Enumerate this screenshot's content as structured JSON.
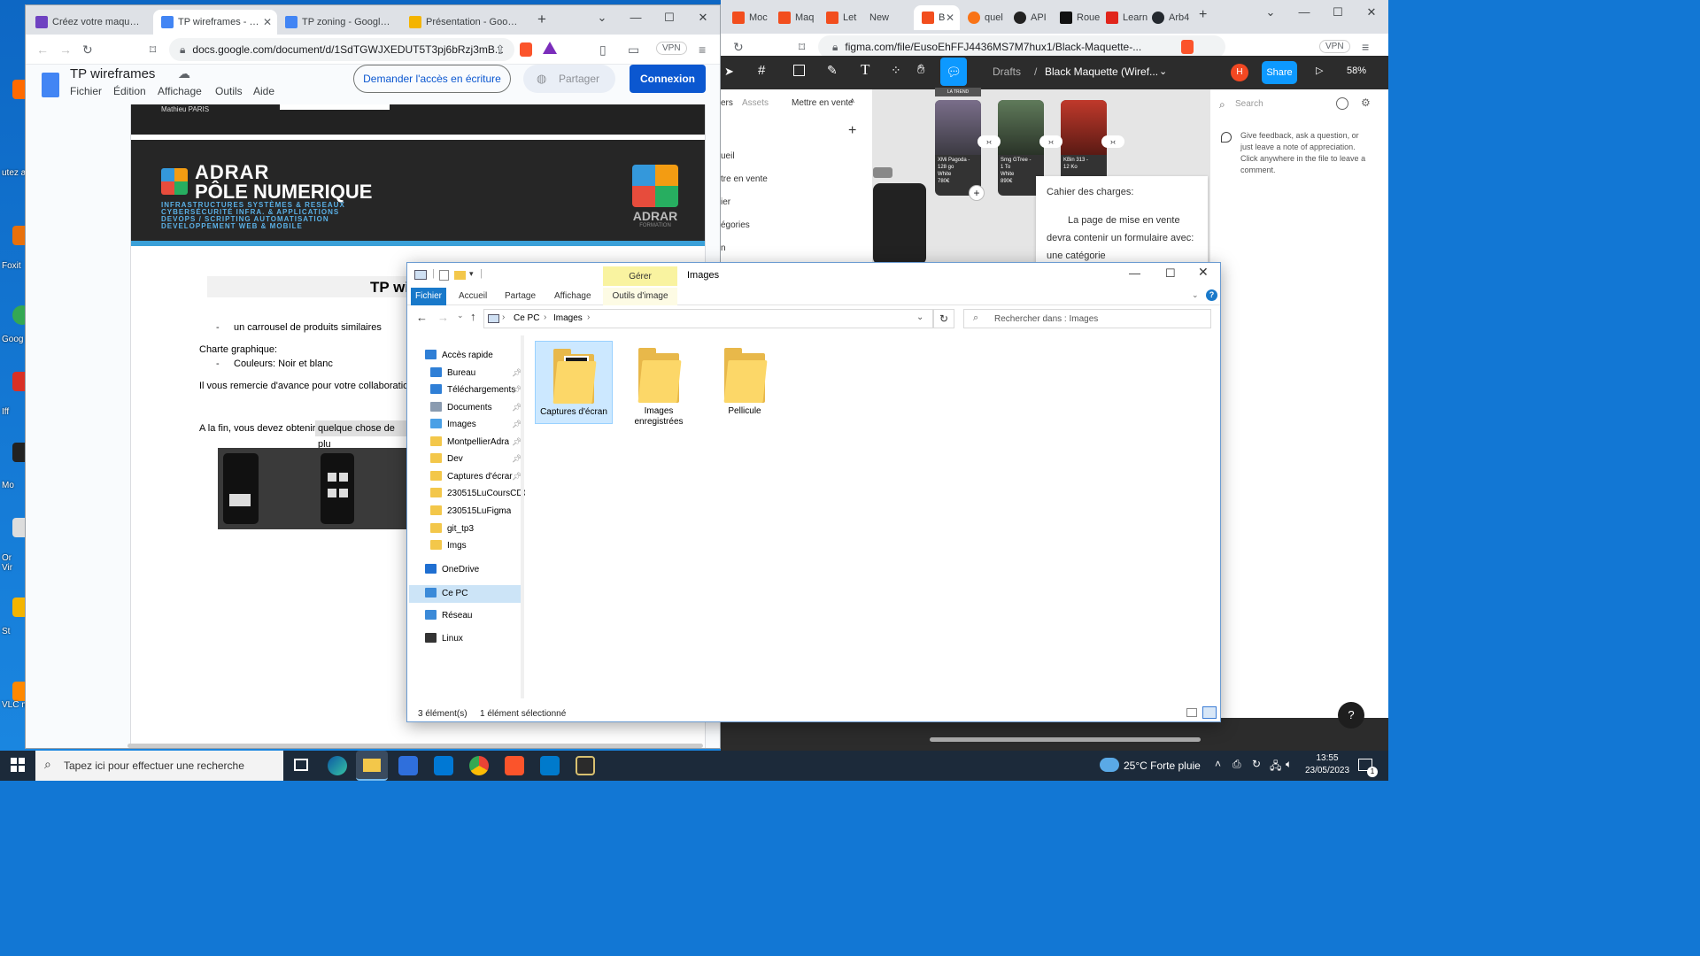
{
  "desktop": {
    "icons": [
      {
        "label": "utez au\nt ici."
      },
      {
        "label": "Foxit"
      },
      {
        "label": "Goog"
      },
      {
        "label": "Iff"
      },
      {
        "label": "Mo"
      },
      {
        "label": "Or\nVir"
      },
      {
        "label": "St"
      },
      {
        "label": "VLC m"
      }
    ]
  },
  "docs_window": {
    "tabs": [
      {
        "label": "Créez votre maquette ave",
        "color": "#6f42c1"
      },
      {
        "label": "TP wireframes - Goog",
        "color": "#4285f4"
      },
      {
        "label": "TP zoning - Google Docs",
        "color": "#4285f4"
      },
      {
        "label": "Présentation - Google Sli",
        "color": "#f4b400"
      }
    ],
    "url": "docs.google.com/document/d/1SdTGWJXEDUT5T3pj6bRzj3mB...",
    "vpn": "VPN",
    "doc_title": "TP wireframes",
    "menu": [
      "Fichier",
      "Édition",
      "Affichage",
      "Outils",
      "Aide"
    ],
    "request_btn": "Demander l'accès en écriture",
    "share_btn": "Partager",
    "login_btn": "Connexion",
    "page": {
      "author": "Mathieu PARIS",
      "banner_line1": "ADRAR",
      "banner_line2": "PÔLE NUMERIQUE",
      "banner_sub1": "INFRASTRUCTURES SYSTÈMES & RESEAUX",
      "banner_sub2": "CYBERSÉCURITÉ INFRA. & APPLICATIONS",
      "banner_sub3": "DEVOPS / SCRIPTING AUTOMATISATION",
      "banner_sub4": "DEVELOPPEMENT WEB & MOBILE",
      "logo_text": "ADRAR",
      "logo_sub": "FORMATION",
      "heading": "TP wi",
      "bullet1": "un carrousel de produits similaires",
      "charte": "Charte graphique:",
      "bullet2": "Couleurs: Noir et blanc",
      "thanks": "Il vous remercie d'avance pour votre collaboratio",
      "end_text_a": "A la fin, vous devez obtenir",
      "end_text_b": "quelque chose de plu"
    }
  },
  "figma_window": {
    "tabs": [
      {
        "label": "Moc"
      },
      {
        "label": "Maq"
      },
      {
        "label": "Let s"
      },
      {
        "label": "New Tab"
      },
      {
        "label": "B"
      },
      {
        "label": "quel"
      },
      {
        "label": "API k"
      },
      {
        "label": "Roue"
      },
      {
        "label": "Learn"
      },
      {
        "label": "Arb4"
      }
    ],
    "url": "figma.com/file/EusoEhFFJ4436MS7M7hux1/Black-Maquette-...",
    "vpn": "VPN",
    "breadcrumb_drafts": "Drafts",
    "file_name": "Black Maquette (Wiref...",
    "avatar": "H",
    "share": "Share",
    "zoom": "58%",
    "panel_tabs": [
      "ers",
      "Assets",
      "Mettre en vente"
    ],
    "layers": [
      "ueil",
      "tre en vente",
      "ier",
      "égories",
      "n"
    ],
    "trend_label": "LA TREND",
    "products": [
      {
        "name": "XMi Pagoda -",
        "detail": "128 go",
        "color": "White",
        "price": "780€"
      },
      {
        "name": "Smg GTree -",
        "detail": "1 To",
        "color": "White",
        "price": "890€"
      },
      {
        "name": "KBin 313 -",
        "detail": "12 Ko",
        "color": "",
        "price": ""
      }
    ],
    "search_placeholder": "Search",
    "comment_hint": "Give feedback, ask a question, or just leave a note of appreciation. Click anywhere in the file to leave a comment.",
    "note_title": "Cahier des charges:",
    "note_body1": "La page de mise en vente",
    "note_body2": "devra contenir un formulaire avec:",
    "note_body3": "une catégorie",
    "help": "?"
  },
  "explorer": {
    "title": "Images",
    "manage_tab": "Gérer",
    "ribbon_tabs": [
      "Fichier",
      "Accueil",
      "Partage",
      "Affichage",
      "Outils d'image"
    ],
    "breadcrumb": [
      "Ce PC",
      "Images"
    ],
    "search_placeholder": "Rechercher dans : Images",
    "nav": [
      {
        "label": "Accès rapide",
        "color": "#2f7fd6",
        "pinned": false,
        "indent": 0
      },
      {
        "label": "Bureau",
        "color": "#2f7fd6",
        "pinned": true,
        "indent": 1
      },
      {
        "label": "Téléchargements",
        "color": "#2f7fd6",
        "pinned": true,
        "indent": 1
      },
      {
        "label": "Documents",
        "color": "#8a9bb0",
        "pinned": true,
        "indent": 1
      },
      {
        "label": "Images",
        "color": "#4aa0e6",
        "pinned": true,
        "indent": 1
      },
      {
        "label": "MontpellierAdra",
        "color": "#f3c74a",
        "pinned": true,
        "indent": 1
      },
      {
        "label": "Dev",
        "color": "#f3c74a",
        "pinned": true,
        "indent": 1
      },
      {
        "label": "Captures d'écrar",
        "color": "#f3c74a",
        "pinned": true,
        "indent": 1
      },
      {
        "label": "230515LuCoursCDC",
        "color": "#f3c74a",
        "pinned": false,
        "indent": 1
      },
      {
        "label": "230515LuFigma",
        "color": "#f3c74a",
        "pinned": false,
        "indent": 1
      },
      {
        "label": "git_tp3",
        "color": "#f3c74a",
        "pinned": false,
        "indent": 1
      },
      {
        "label": "Imgs",
        "color": "#f3c74a",
        "pinned": false,
        "indent": 1
      },
      {
        "label": "OneDrive",
        "color": "#1f6fd1",
        "pinned": false,
        "indent": 0
      },
      {
        "label": "Ce PC",
        "color": "#3b8ad8",
        "pinned": false,
        "indent": 0
      },
      {
        "label": "Réseau",
        "color": "#3b8ad8",
        "pinned": false,
        "indent": 0
      },
      {
        "label": "Linux",
        "color": "#333333",
        "pinned": false,
        "indent": 0
      }
    ],
    "folders": [
      {
        "label": "Captures d'écran",
        "selected": true
      },
      {
        "label": "Images\nenregistrées",
        "selected": false
      },
      {
        "label": "Pellicule",
        "selected": false
      }
    ],
    "status_count": "3 élément(s)",
    "status_selected": "1 élément sélectionné"
  },
  "taskbar": {
    "search_placeholder": "Tapez ici pour effectuer une recherche",
    "weather": "25°C  Forte pluie",
    "time": "13:55",
    "date": "23/05/2023",
    "notif_count": "1"
  }
}
